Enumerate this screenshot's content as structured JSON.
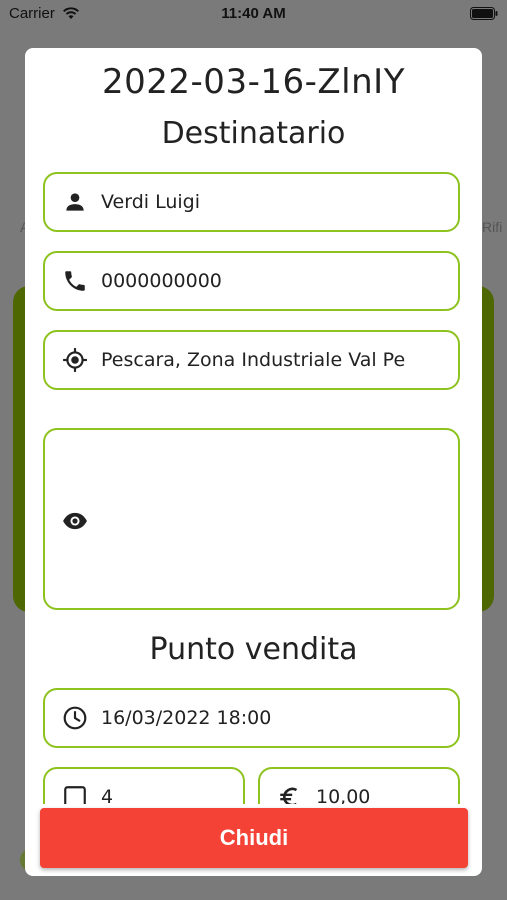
{
  "status_bar": {
    "carrier": "Carrier",
    "time": "11:40 AM"
  },
  "background": {
    "left_text": "A",
    "right_text": "Rifi"
  },
  "modal": {
    "order_code": "2022-03-16-ZlnIY",
    "recipient_title": "Destinatario",
    "recipient": {
      "name": "Verdi Luigi",
      "phone": "0000000000",
      "address": "Pescara, Zona Industriale Val Pe",
      "notes": ""
    },
    "store_title": "Punto vendita",
    "store": {
      "datetime": "16/03/2022 18:00",
      "quantity": "4",
      "price": "10,00"
    },
    "close_label": "Chiudi"
  },
  "colors": {
    "field_border": "#8dc21f",
    "close_button": "#f44336",
    "background_card": "#4e6700"
  },
  "icons": {
    "name": "person-icon",
    "phone": "phone-icon",
    "address": "location-target-icon",
    "notes": "eye-icon",
    "datetime": "clock-icon",
    "quantity": "box-icon",
    "price": "euro-icon"
  }
}
